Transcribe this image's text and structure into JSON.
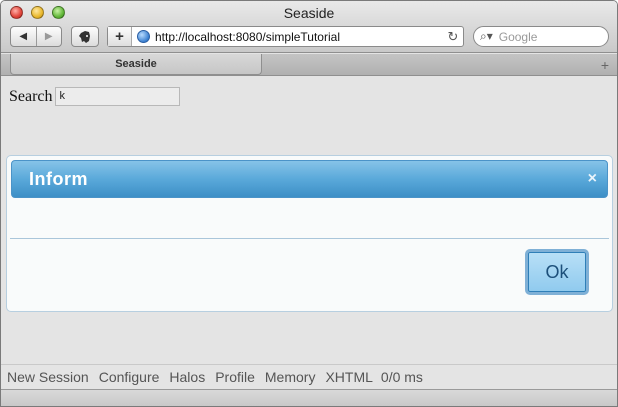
{
  "window": {
    "title": "Seaside"
  },
  "browser": {
    "url": "http://localhost:8080/simpleTutorial",
    "search_placeholder": "Google",
    "tab_label": "Seaside",
    "back_icon": "◀",
    "forward_icon": "▶",
    "add_icon": "+",
    "reload_icon": "↻",
    "tab_add_icon": "+",
    "search_icon": "⌕▾"
  },
  "page": {
    "search_label": "Search",
    "search_value": "k"
  },
  "dialog": {
    "title": "Inform",
    "close_icon": "×",
    "ok_label": "Ok"
  },
  "toolbar": {
    "items": [
      "New Session",
      "Configure",
      "Halos",
      "Profile",
      "Memory",
      "XHTML"
    ],
    "timing": "0/0 ms"
  }
}
